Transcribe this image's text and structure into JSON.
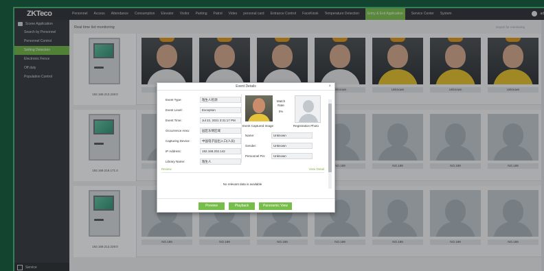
{
  "app": {
    "logo": "ZKTeco",
    "logo_sub": "",
    "user_name": "ad"
  },
  "topnav": {
    "items": [
      "Personnel",
      "Access",
      "Attendance",
      "Consumption",
      "Elevator",
      "Visitor",
      "Parking",
      "Patrol",
      "Video",
      "personal card",
      "Entrance Control",
      "FaceKiosk",
      "Temperature Detection",
      "Entry & Exit Application",
      "Service Center",
      "System"
    ],
    "active_index": 13
  },
  "sidebar": {
    "section_title": "Scene Application",
    "items": [
      "Search by Personnel",
      "Personnel Control",
      "Setting Detection",
      "Electronic Fence",
      "Off duty",
      "Population Control"
    ],
    "active_index": 2,
    "bottom_label": "Service"
  },
  "content": {
    "breadcrumb": "Real time list monitoring",
    "breadcrumb_right": "Export for monitoring",
    "rows": [
      {
        "door_ip": "192.168.213.228:0",
        "faces": [
          {
            "label": "",
            "kind": "photo-mask"
          },
          {
            "label": "",
            "kind": "photo-mask"
          },
          {
            "label": "",
            "kind": "photo"
          },
          {
            "label": "Unknown",
            "kind": "photo"
          },
          {
            "label": "Unknown",
            "kind": "photo-yellow"
          },
          {
            "label": "Unknown",
            "kind": "photo-yellow"
          },
          {
            "label": "Unknown",
            "kind": "photo-yellow"
          }
        ]
      },
      {
        "door_ip": "192.168.216.171:4",
        "faces": [
          {
            "label": "",
            "kind": "gray"
          },
          {
            "label": "",
            "kind": "gray"
          },
          {
            "label": "",
            "kind": "gray"
          },
          {
            "label": "NO.199",
            "kind": "gray"
          },
          {
            "label": "NO.199",
            "kind": "gray"
          },
          {
            "label": "NO.199",
            "kind": "gray"
          },
          {
            "label": "NO.199",
            "kind": "gray"
          }
        ]
      },
      {
        "door_ip": "192.168.213.228:0",
        "faces": [
          {
            "label": "NO.199",
            "kind": "gray"
          },
          {
            "label": "NO.199",
            "kind": "gray"
          },
          {
            "label": "NO.199",
            "kind": "gray"
          },
          {
            "label": "NO.199",
            "kind": "gray"
          },
          {
            "label": "NO.199",
            "kind": "gray"
          },
          {
            "label": "NO.199",
            "kind": "gray"
          },
          {
            "label": "NO.199",
            "kind": "gray"
          }
        ]
      }
    ]
  },
  "modal": {
    "title": "Event Details",
    "fields": [
      {
        "key": "Event Type:",
        "value": "陌生人检测"
      },
      {
        "key": "Event Level:",
        "value": "Exception"
      },
      {
        "key": "Event Time:",
        "value": "Jul 22, 2021 3:31:17 PM"
      },
      {
        "key": "Occurrence Area:",
        "value": "园区东侧区域"
      },
      {
        "key": "Capturing Device:",
        "value": "中国电子园出入口(人员)"
      },
      {
        "key": "IP Address:",
        "value": "192.168.202.142"
      },
      {
        "key": "Library Name:",
        "value": "陌生人"
      }
    ],
    "match_label": "Match Rate",
    "match_value": "0%",
    "captured_caption": "Event Captured Image",
    "registration_caption": "Registration Photo",
    "person_fields": [
      {
        "key": "Name:",
        "value": "Unknown"
      },
      {
        "key": "Gender:",
        "value": "Unknown"
      },
      {
        "key": "Personnel Pin:",
        "value": "Unknown"
      }
    ],
    "section_left": "Review",
    "section_right": "View Detail",
    "no_data": "No relevant data is available",
    "buttons": [
      "Preview",
      "Playback",
      "Panoramic View"
    ]
  }
}
